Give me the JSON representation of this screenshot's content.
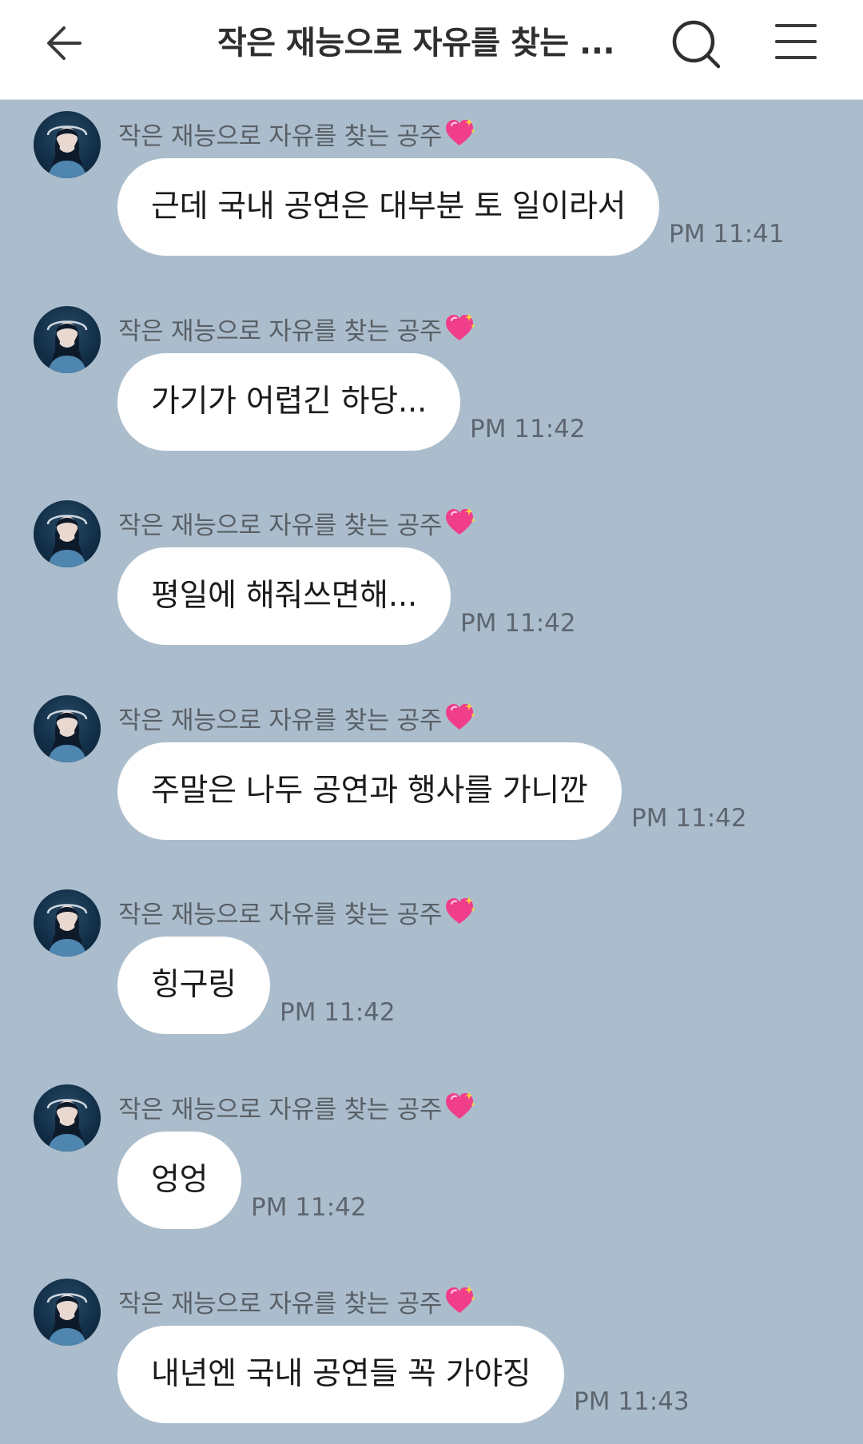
{
  "header": {
    "title": "작은 재능으로 자유를 찾는 ...",
    "back_icon": "back-arrow-icon",
    "search_icon": "search-icon",
    "menu_icon": "menu-icon"
  },
  "colors": {
    "background": "#abbdcc",
    "header_bg": "#ffffff",
    "bubble_bg": "#ffffff",
    "heart": "#f03e8a"
  },
  "messages": [
    {
      "sender": "작은 재능으로 자유를 찾는 공주",
      "text": "근데 국내 공연은 대부분 토 일이라서",
      "time": "PM 11:41"
    },
    {
      "sender": "작은 재능으로 자유를 찾는 공주",
      "text": "가기가 어렵긴 하당...",
      "time": "PM 11:42"
    },
    {
      "sender": "작은 재능으로 자유를 찾는 공주",
      "text": "평일에 해줘쓰면해...",
      "time": "PM 11:42"
    },
    {
      "sender": "작은 재능으로 자유를 찾는 공주",
      "text": "주말은 나두 공연과 행사를 가니깐",
      "time": "PM 11:42"
    },
    {
      "sender": "작은 재능으로 자유를 찾는 공주",
      "text": "힝구링",
      "time": "PM 11:42"
    },
    {
      "sender": "작은 재능으로 자유를 찾는 공주",
      "text": "엉엉",
      "time": "PM 11:42"
    },
    {
      "sender": "작은 재능으로 자유를 찾는 공주",
      "text": "내년엔 국내 공연들 꼭 가야징",
      "time": "PM 11:43"
    }
  ]
}
